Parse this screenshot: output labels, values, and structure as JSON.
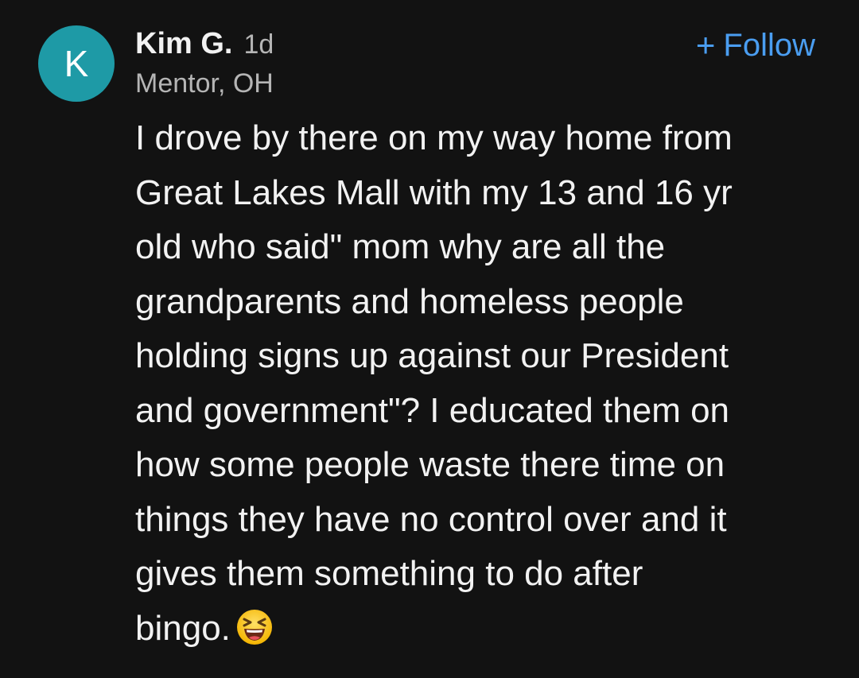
{
  "comment": {
    "avatar_initial": "K",
    "avatar_color": "#1e9aa6",
    "username": "Kim G.",
    "timestamp": "1d",
    "location": "Mentor, OH",
    "follow_button": {
      "icon": "plus-icon",
      "icon_glyph": "+",
      "label": "Follow",
      "color": "#4a9df0"
    },
    "body_lines": [
      "I drove by there on my way home from",
      "Great Lakes Mall with my 13 and 16 yr",
      "old who said\" mom why are all the",
      "grandparents and homeless people",
      "holding signs up against our President",
      "and government\"? I educated them on",
      "how some people waste there time on",
      "things they have no control over and it",
      "gives them something to do after",
      "bingo."
    ],
    "trailing_emoji": "laughing-squinting-face-icon"
  }
}
